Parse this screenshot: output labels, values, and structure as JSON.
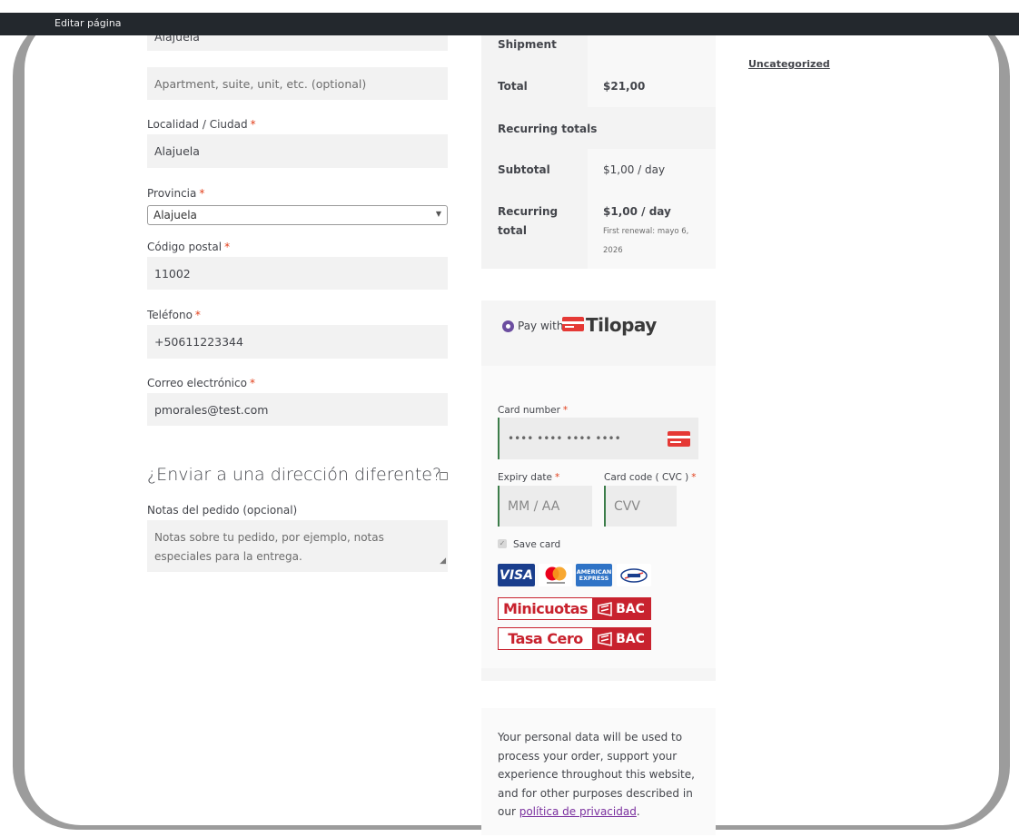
{
  "adminbar": {
    "label": "Editar página"
  },
  "form": {
    "address1_value": "Alajuela",
    "address2_placeholder": "Apartment, suite, unit, etc. (optional)",
    "city": {
      "label": "Localidad / Ciudad",
      "value": "Alajuela"
    },
    "province": {
      "label": "Provincia",
      "value": "Alajuela"
    },
    "postcode": {
      "label": "Código postal",
      "value": "11002"
    },
    "phone": {
      "label": "Teléfono",
      "value": "+50611223344"
    },
    "email": {
      "label": "Correo electrónico",
      "value": "pmorales@test.com"
    },
    "required_mark": "*",
    "ship_different": "¿Enviar a una dirección diferente?",
    "notes": {
      "label": "Notas del pedido (opcional)",
      "placeholder": "Notas sobre tu pedido, por ejemplo, notas especiales para la entrega."
    }
  },
  "review": {
    "shipment_label": "Shipment",
    "total_label": "Total",
    "total_value": "$21,00",
    "recurring_totals_label": "Recurring totals",
    "subtotal_label": "Subtotal",
    "subtotal_value": "$1,00 / day",
    "recurring_total_label_1": "Recurring",
    "recurring_total_label_2": "total",
    "recurring_total_value": "$1,00 / day",
    "first_renewal_1": "First renewal: mayo 6,",
    "first_renewal_2": "2026"
  },
  "payment": {
    "pay_with": "Pay with",
    "brand": "Tilopay",
    "card_number": {
      "label": "Card number",
      "placeholder": "•••• •••• •••• ••••"
    },
    "expiry": {
      "label": "Expiry date",
      "placeholder": "MM / AA"
    },
    "cvc": {
      "label": "Card code ( CVC )",
      "placeholder": "CVV"
    },
    "save_card": "Save card",
    "logos": {
      "visa": "VISA",
      "amex_1": "AMERICAN",
      "amex_2": "EXPRESS"
    },
    "minicuotas": "Minicuotas",
    "tasa_cero": "Tasa Cero",
    "bac": "BAC"
  },
  "privacy": {
    "text": "Your personal data will be used to process your order, support your experience throughout this website, and for other purposes described in our",
    "link": "política de privacidad",
    "end": "."
  },
  "sidebar": {
    "category": "Uncategorized"
  },
  "colors": {
    "accent": "#6c4ea0",
    "required": "#e2401c",
    "bac_red": "#c8222e",
    "input_border": "#3c7d4a"
  }
}
